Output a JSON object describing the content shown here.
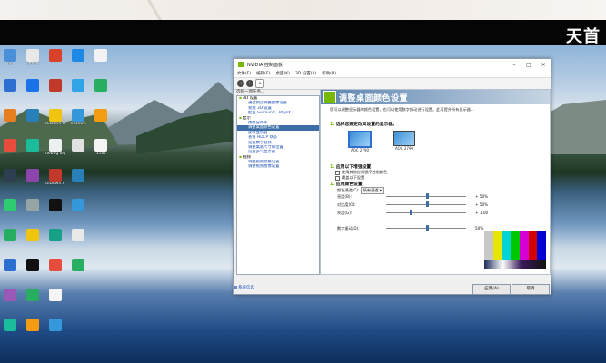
{
  "brand_overlay": "天首",
  "desktop_icons": [
    {
      "label": "bb",
      "color": "#4a90d9",
      "col": 0,
      "row": 0
    },
    {
      "label": "Office",
      "color": "#e8e8e8",
      "col": 1,
      "row": 0
    },
    {
      "label": "",
      "color": "#d9412b",
      "col": 2,
      "row": 0
    },
    {
      "label": "",
      "color": "#1e88e5",
      "col": 3,
      "row": 0
    },
    {
      "label": "",
      "color": "#f2f2f2",
      "col": 4,
      "row": 0
    },
    {
      "label": "",
      "color": "#2d6fd0",
      "col": 0,
      "row": 1
    },
    {
      "label": "",
      "color": "#1a73e8",
      "col": 1,
      "row": 1
    },
    {
      "label": "",
      "color": "#c0392b",
      "col": 2,
      "row": 1
    },
    {
      "label": "",
      "color": "#2fa4e7",
      "col": 3,
      "row": 1
    },
    {
      "label": "",
      "color": "#27ae60",
      "col": 4,
      "row": 1
    },
    {
      "label": "",
      "color": "#e67e22",
      "col": 0,
      "row": 2
    },
    {
      "label": "",
      "color": "#2980b9",
      "col": 1,
      "row": 2
    },
    {
      "label": "UiDown.exe",
      "color": "#f1c40f",
      "col": 2,
      "row": 2
    },
    {
      "label": "UiDown",
      "color": "#3498db",
      "col": 3,
      "row": 2
    },
    {
      "label": "",
      "color": "#f39c12",
      "col": 4,
      "row": 2
    },
    {
      "label": "",
      "color": "#e74c3c",
      "col": 0,
      "row": 3
    },
    {
      "label": "",
      "color": "#1abc9c",
      "col": 1,
      "row": 3
    },
    {
      "label": "debug.log",
      "color": "#ecf0f1",
      "col": 2,
      "row": 3
    },
    {
      "label": "",
      "color": "#e1e1e1",
      "col": 3,
      "row": 3
    },
    {
      "label": "1.txt",
      "color": "#f5f5f5",
      "col": 4,
      "row": 3
    },
    {
      "label": "",
      "color": "#2c3e50",
      "col": 0,
      "row": 4
    },
    {
      "label": "",
      "color": "#8e44ad",
      "col": 1,
      "row": 4
    },
    {
      "label": "UiDown.rar",
      "color": "#c0392b",
      "col": 2,
      "row": 4
    },
    {
      "label": "",
      "color": "#2980b9",
      "col": 3,
      "row": 4
    },
    {
      "label": "",
      "color": "#2ecc71",
      "col": 0,
      "row": 5
    },
    {
      "label": "",
      "color": "#95a5a6",
      "col": 1,
      "row": 5
    },
    {
      "label": "",
      "color": "#111111",
      "col": 2,
      "row": 5
    },
    {
      "label": "",
      "color": "#3498db",
      "col": 3,
      "row": 5
    },
    {
      "label": "",
      "color": "#27ae60",
      "col": 0,
      "row": 6
    },
    {
      "label": "",
      "color": "#f1c40f",
      "col": 1,
      "row": 6
    },
    {
      "label": "",
      "color": "#16a085",
      "col": 2,
      "row": 6
    },
    {
      "label": "",
      "color": "#e8e8e8",
      "col": 3,
      "row": 6
    },
    {
      "label": "",
      "color": "#2d6fd0",
      "col": 0,
      "row": 7
    },
    {
      "label": "",
      "color": "#111111",
      "col": 1,
      "row": 7
    },
    {
      "label": "",
      "color": "#e74c3c",
      "col": 2,
      "row": 7
    },
    {
      "label": "",
      "color": "#27ae60",
      "col": 3,
      "row": 7
    },
    {
      "label": "",
      "color": "#9b59b6",
      "col": 0,
      "row": 8
    },
    {
      "label": "",
      "color": "#27ae60",
      "col": 1,
      "row": 8
    },
    {
      "label": "",
      "color": "#f5f5f5",
      "col": 2,
      "row": 8
    },
    {
      "label": "",
      "color": "#1abc9c",
      "col": 0,
      "row": 9
    },
    {
      "label": "",
      "color": "#f39c12",
      "col": 1,
      "row": 9
    },
    {
      "label": "",
      "color": "#3498db",
      "col": 2,
      "row": 9
    }
  ],
  "window": {
    "title": "NVIDIA 控制面板",
    "menu": [
      "文件(F)",
      "编辑(E)",
      "桌面(K)",
      "3D 设置(3)",
      "帮助(H)"
    ],
    "task_header": "选择一项任务...",
    "tree": [
      {
        "text": "3D 设置",
        "kind": "cat"
      },
      {
        "text": "通过预览调整图像设置",
        "kind": "sub"
      },
      {
        "text": "管理 3D 设置",
        "kind": "sub"
      },
      {
        "text": "配置 Surround、PhysX",
        "kind": "sub"
      },
      {
        "text": "显示",
        "kind": "cat"
      },
      {
        "text": "更改分辨率",
        "kind": "sub"
      },
      {
        "text": "调整桌面颜色设置",
        "kind": "sel"
      },
      {
        "text": "旋转显示器",
        "kind": "sub"
      },
      {
        "text": "查看 HDCP 状态",
        "kind": "sub"
      },
      {
        "text": "设置数字音频",
        "kind": "sub"
      },
      {
        "text": "调整桌面尺寸和位置",
        "kind": "sub"
      },
      {
        "text": "设置多个显示器",
        "kind": "sub"
      },
      {
        "text": "视频",
        "kind": "cat"
      },
      {
        "text": "调整视频颜色设置",
        "kind": "sub"
      },
      {
        "text": "调整视频图像设置",
        "kind": "sub"
      }
    ],
    "system_info": "系统信息",
    "page_title": "调整桌面颜色设置",
    "page_desc": "您可以调整显示器的颜色设置，也可以使用数字振动进行设置。此可提升所有显示器...",
    "section1": "选择您要更改其设置的显示器。",
    "displays": [
      {
        "label": "AOC 2790",
        "selected": true
      },
      {
        "label": "AOC 2790",
        "selected": false
      }
    ],
    "section2": "应用以下增强设置",
    "opt_a": "使用其他应用程序控制颜色",
    "opt_b": "覆盖以下设置",
    "section3": "应用颜色设置",
    "color_channel_label": "颜色通道(C):",
    "color_channel_value": "所有通道",
    "sliders": [
      {
        "label": "亮度(B):",
        "value": "+ 50%",
        "pos": 0.5
      },
      {
        "label": "对比度(O):",
        "value": "+ 50%",
        "pos": 0.5
      },
      {
        "label": "灰度(G):",
        "value": "+ 1.00",
        "pos": 0.3
      }
    ],
    "digital_vibrance": {
      "label": "数字振动(D):",
      "value": "50%",
      "pos": 0.5
    },
    "apply_button": "应用(A)",
    "cancel_button": "取消"
  }
}
